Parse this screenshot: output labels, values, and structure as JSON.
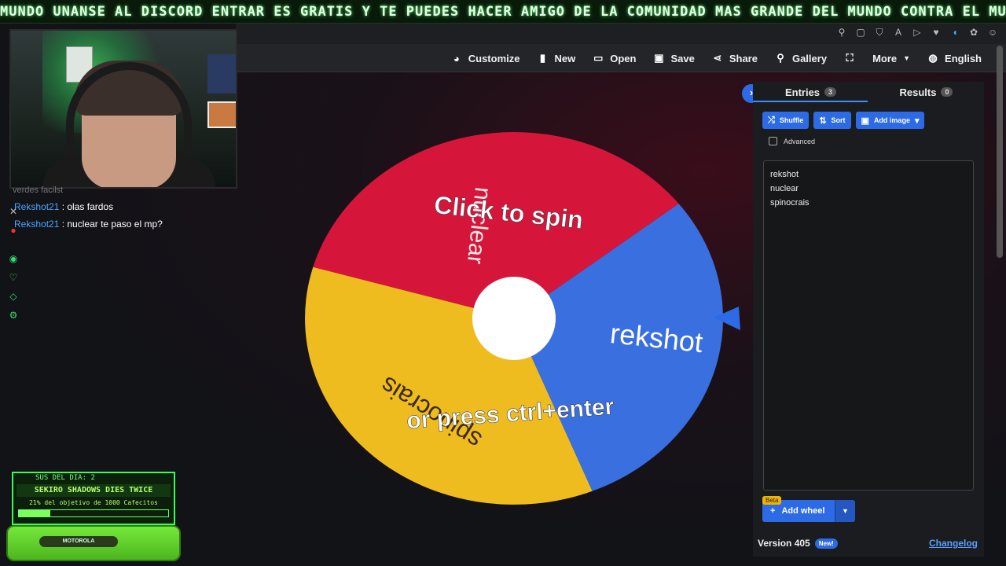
{
  "marquee": {
    "text": "MUNDO UNANSE AL DISCORD ENTRAR ES GRATIS Y TE PUEDES HACER AMIGO DE LA COMUNIDAD MAS GRANDE DEL MUNDO CONTRA EL MUNDO SENDO"
  },
  "nav": {
    "items": [
      {
        "label": "Customize",
        "icon": "palette-icon"
      },
      {
        "label": "New",
        "icon": "file-icon"
      },
      {
        "label": "Open",
        "icon": "folder-icon"
      },
      {
        "label": "Save",
        "icon": "save-icon"
      },
      {
        "label": "Share",
        "icon": "share-icon"
      },
      {
        "label": "Gallery",
        "icon": "search-icon"
      },
      {
        "label": "",
        "icon": "fullscreen-icon"
      },
      {
        "label": "More",
        "icon": "caret-down-icon"
      },
      {
        "label": "English",
        "icon": "globe-icon"
      }
    ]
  },
  "chat": {
    "faint": "verdes facilst",
    "messages": [
      {
        "user": "Rekshot21",
        "text": ": olas fardos"
      },
      {
        "user": "Rekshot21",
        "text": ": nuclear te paso el mp?"
      }
    ]
  },
  "widget": {
    "subs_label": "SUS DEL DIA:",
    "subs_count": "2",
    "title": "SEKIRO SHADOWS DIES TWICE",
    "goal": "21% del objetivo de 1000 Cafecitos",
    "progress": 0.21,
    "brand": "MOTOROLA"
  },
  "wheel": {
    "slices": [
      {
        "label": "nuclear",
        "color": "#d5163a"
      },
      {
        "label": "rekshot",
        "color": "#3a6fe0"
      },
      {
        "label": "spinocrais",
        "color": "#efbc20"
      }
    ],
    "center_color": "#ffffff",
    "spin_text": "Click to spin",
    "press_text": "or press ctrl+enter"
  },
  "panel": {
    "tabs": [
      {
        "label": "Entries",
        "count": "3"
      },
      {
        "label": "Results",
        "count": "0"
      }
    ],
    "buttons": {
      "shuffle": "Shuffle",
      "sort": "Sort",
      "add_image": "Add image"
    },
    "advanced_label": "Advanced",
    "entries": [
      "rekshot",
      "nuclear",
      "spinocrais"
    ],
    "beta_label": "Beta",
    "add_wheel_label": "Add wheel",
    "version": "Version 405",
    "new_badge": "New!",
    "changelog": "Changelog"
  },
  "colors": {
    "accent": "#2d6be6",
    "bg": "#121418"
  }
}
